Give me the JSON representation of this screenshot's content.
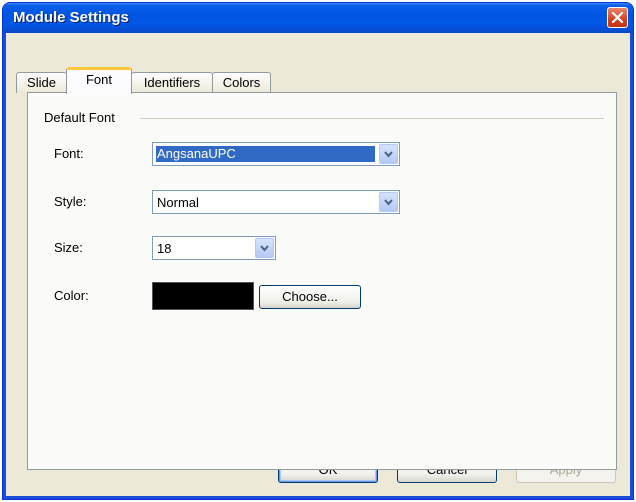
{
  "window": {
    "title": "Module Settings"
  },
  "tabs": [
    {
      "label": "Slide",
      "active": false
    },
    {
      "label": "Font",
      "active": true
    },
    {
      "label": "Identifiers",
      "active": false
    },
    {
      "label": "Colors",
      "active": false
    }
  ],
  "group": {
    "label": "Default Font"
  },
  "fields": {
    "font": {
      "label": "Font:",
      "value": "AngsanaUPC"
    },
    "style": {
      "label": "Style:",
      "value": "Normal"
    },
    "size": {
      "label": "Size:",
      "value": "18"
    },
    "color": {
      "label": "Color:",
      "value": "#000000",
      "choose_label": "Choose..."
    }
  },
  "buttons": {
    "ok": "OK",
    "cancel": "Cancel",
    "apply": "Apply"
  },
  "colors": {
    "titlebar": "#0054e3",
    "selection": "#316ac5",
    "close": "#d4431f"
  }
}
